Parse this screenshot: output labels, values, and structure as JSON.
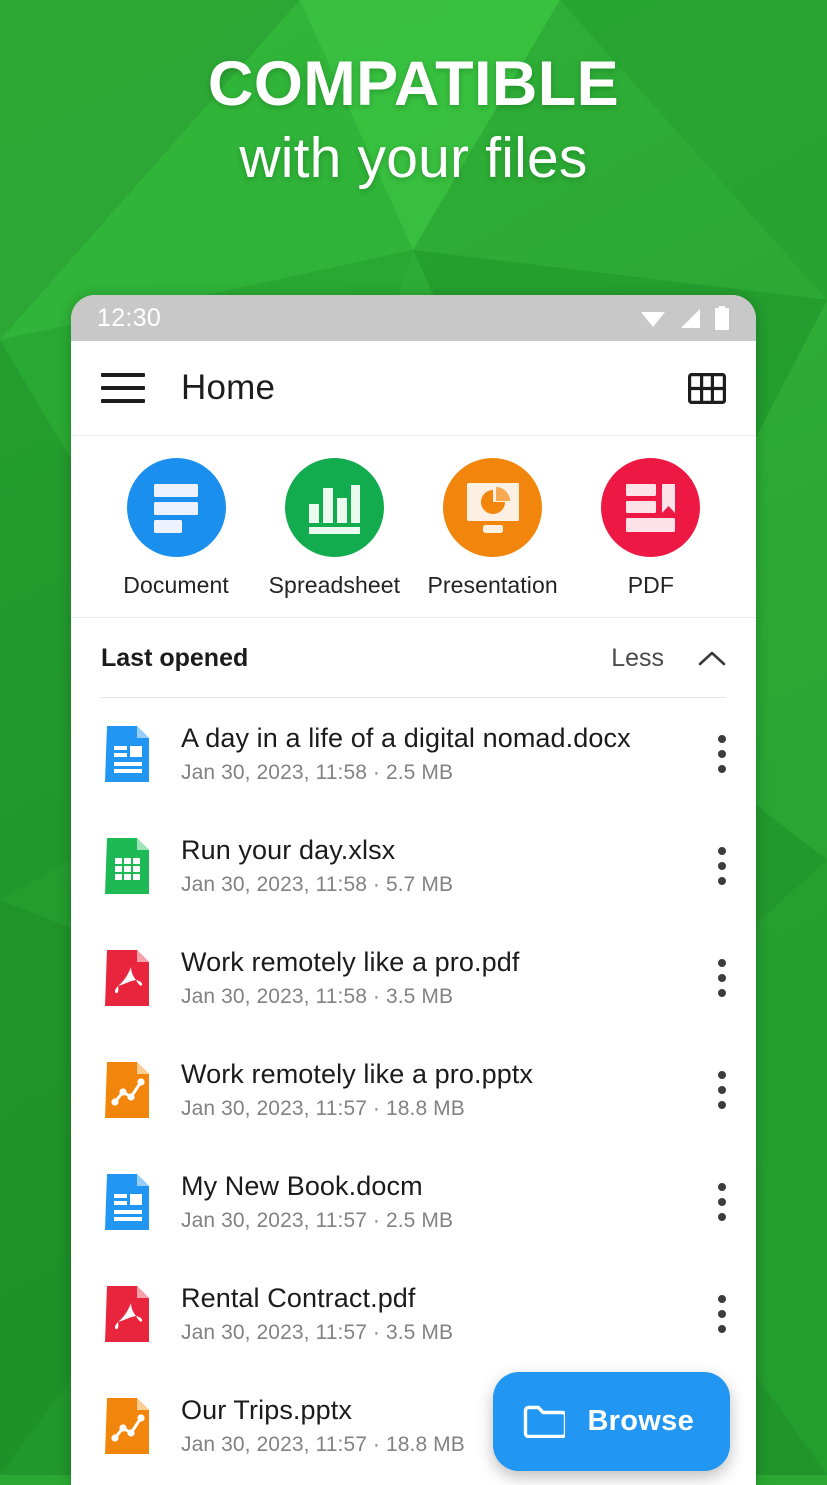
{
  "promo": {
    "headline_line1": "COMPATIBLE",
    "headline_line2": "with your files",
    "background_color": "#2aa832",
    "text_color": "#ffffff"
  },
  "phone": {
    "status_bar": {
      "clock": "12:30",
      "icons": [
        "wifi-icon",
        "cellular-signal-icon",
        "battery-icon"
      ],
      "background_color": "#c8c8c8"
    },
    "app_bar": {
      "menu_icon": "hamburger-menu-icon",
      "title": "Home",
      "view_toggle_icon": "grid-view-icon"
    },
    "categories": [
      {
        "label": "Document",
        "icon": "document-icon",
        "color": "#1a8fee"
      },
      {
        "label": "Spreadsheet",
        "icon": "spreadsheet-icon",
        "color": "#12ac4e"
      },
      {
        "label": "Presentation",
        "icon": "presentation-icon",
        "color": "#f2860d"
      },
      {
        "label": "PDF",
        "icon": "pdf-icon",
        "color": "#ed1944"
      }
    ],
    "section": {
      "title": "Last opened",
      "toggle_label": "Less",
      "toggle_icon": "chevron-up-icon"
    },
    "files": [
      {
        "name": "A day in a life of a digital nomad.docx",
        "date": "Jan 30, 2023, 11:58",
        "size": "2.5 MB",
        "subtitle": "Jan 30, 2023, 11:58  ·  2.5 MB",
        "type": "docx",
        "icon": "word-document-file-icon",
        "color": "#2196f3"
      },
      {
        "name": "Run your day.xlsx",
        "date": "Jan 30, 2023, 11:58",
        "size": "5.7 MB",
        "subtitle": "Jan 30, 2023, 11:58  ·  5.7 MB",
        "type": "xlsx",
        "icon": "spreadsheet-file-icon",
        "color": "#1db954"
      },
      {
        "name": "Work remotely like a pro.pdf",
        "date": "Jan 30, 2023, 11:58",
        "size": "3.5 MB",
        "subtitle": "Jan 30, 2023, 11:58  ·  3.5 MB",
        "type": "pdf",
        "icon": "pdf-file-icon",
        "color": "#e8253c"
      },
      {
        "name": "Work remotely like a pro.pptx",
        "date": "Jan 30, 2023, 11:57",
        "size": "18.8 MB",
        "subtitle": "Jan 30, 2023, 11:57  ·  18.8 MB",
        "type": "pptx",
        "icon": "presentation-file-icon",
        "color": "#f2860d"
      },
      {
        "name": "My New Book.docm",
        "date": "Jan 30, 2023, 11:57",
        "size": "2.5 MB",
        "subtitle": "Jan 30, 2023, 11:57  ·  2.5 MB",
        "type": "docm",
        "icon": "word-document-file-icon",
        "color": "#2196f3"
      },
      {
        "name": "Rental Contract.pdf",
        "date": "Jan 30, 2023, 11:57",
        "size": "3.5 MB",
        "subtitle": "Jan 30, 2023, 11:57  ·  3.5 MB",
        "type": "pdf",
        "icon": "pdf-file-icon",
        "color": "#e8253c"
      },
      {
        "name": "Our Trips.pptx",
        "date": "Jan 30, 2023, 11:57",
        "size": "18.8 MB",
        "subtitle": "Jan 30, 2023, 11:57  ·  18.8 MB",
        "type": "pptx",
        "icon": "presentation-file-icon",
        "color": "#f2860d"
      }
    ],
    "fab": {
      "label": "Browse",
      "icon": "folder-icon",
      "color": "#2196f3"
    }
  }
}
